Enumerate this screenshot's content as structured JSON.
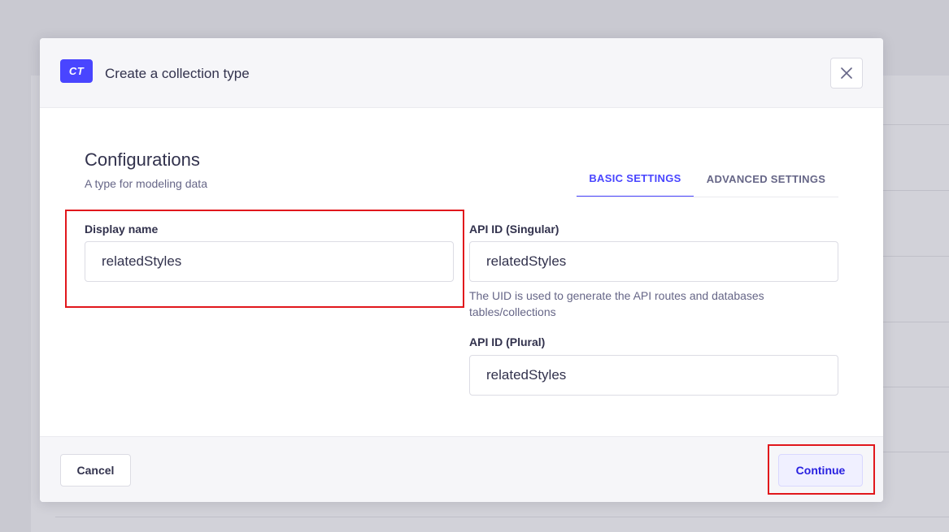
{
  "modal": {
    "badge": "CT",
    "title": "Create a collection type",
    "close_icon": "close-icon"
  },
  "configurations": {
    "title": "Configurations",
    "subtitle": "A type for modeling data"
  },
  "tabs": [
    {
      "label": "BASIC SETTINGS",
      "active": true
    },
    {
      "label": "ADVANCED SETTINGS",
      "active": false
    }
  ],
  "fields": {
    "display_name": {
      "label": "Display name",
      "value": "relatedStyles"
    },
    "api_id_singular": {
      "label": "API ID (Singular)",
      "value": "relatedStyles",
      "hint": "The UID is used to generate the API routes and databases tables/collections"
    },
    "api_id_plural": {
      "label": "API ID (Plural)",
      "value": "relatedStyles"
    }
  },
  "footer": {
    "cancel_label": "Cancel",
    "continue_label": "Continue"
  },
  "colors": {
    "primary": "#4945ff",
    "highlight": "#e1171c"
  }
}
